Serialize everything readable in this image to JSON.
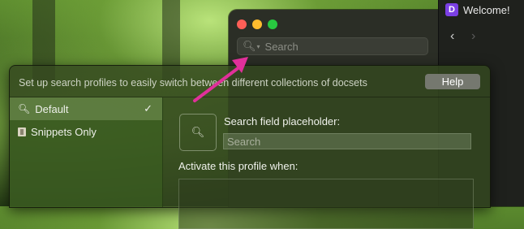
{
  "back_window": {
    "search_placeholder": "Search",
    "welcome_tab": {
      "icon_letter": "D",
      "label": "Welcome!"
    },
    "nav_back": "‹",
    "nav_forward": "›"
  },
  "sheet": {
    "description": "Set up search profiles to easily switch between different collections of docsets",
    "help_label": "Help",
    "profiles": [
      {
        "label": "Default",
        "icon": "magnifier-icon",
        "selected": true,
        "check": "✓"
      },
      {
        "label": "Snippets Only",
        "icon": "snippet-icon",
        "selected": false
      }
    ],
    "field_label": "Search field placeholder:",
    "placeholder_value": "Search",
    "activate_label": "Activate this profile when:"
  },
  "colors": {
    "arrow": "#e0309a",
    "accent": "#7b3fe4"
  }
}
